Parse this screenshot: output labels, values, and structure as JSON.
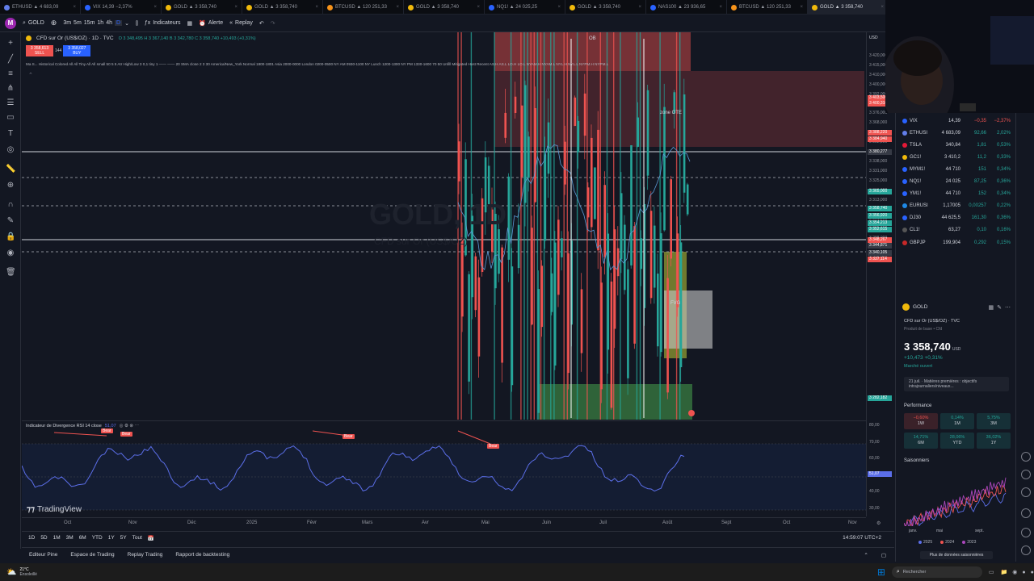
{
  "tabs": [
    {
      "label": "ETHUSD ▲ 4 683,09",
      "color": "#627eea"
    },
    {
      "label": "VIX 14,39 −2,37%",
      "color": "#2962ff"
    },
    {
      "label": "GOLD ▲ 3 358,740",
      "color": "#f0b90b"
    },
    {
      "label": "GOLD ▲ 3 358,740",
      "color": "#f0b90b"
    },
    {
      "label": "BTCUSD ▲ 120 251,33",
      "color": "#f7931a"
    },
    {
      "label": "GOLD ▲ 3 358,740",
      "color": "#f0b90b"
    },
    {
      "label": "NQ1! ▲ 24 025,25",
      "color": "#2962ff"
    },
    {
      "label": "GOLD ▲ 3 358,740",
      "color": "#f0b90b"
    },
    {
      "label": "NAS100 ▲ 23 936,65",
      "color": "#2962ff"
    },
    {
      "label": "BTCUSD ▲ 120 251,33",
      "color": "#f7931a"
    },
    {
      "label": "GOLD ▲ 3 358,740",
      "color": "#f0b90b"
    }
  ],
  "toolbar": {
    "symbol": "GOLD",
    "intervals": [
      "3m",
      "5m",
      "15m",
      "1h",
      "4h",
      "D"
    ],
    "indicators_label": "Indicateurs",
    "alert_label": "Alerte",
    "replay_label": "Replay"
  },
  "chart": {
    "title": "CFD sur Or (US$/OZ) · 1D · TVC",
    "ohlc": "O 3 348,495  H 3 367,140  B 3 342,780  C 3 358,740  +10,493 (+0,31%)",
    "sell_price": "3 358,613",
    "sell_label": "SELL",
    "spread": "144",
    "buy_price": "3 358,027",
    "buy_label": "BUY",
    "indicator_line": "Ma S... Historical Colored All All Tiny All All small 50 5 5 Atr High/Low 3 0,1 tiny 1 —— —— 20 SMA close 2 3 30 America/New_York Normal 1800-1801 Asia 2000-0000 London 0200-0500 NY AM 0930-1100 NY Lunch 1200-1300 NY PM 1330-1600 70 50 Unfill Mitigated Host Recent AS.H AS.L LO.H LO.L NYAM.H NYAM.L NYL.H NYL.L NYPM.H NYPM.L",
    "watermark": "GOLD, 1D",
    "watermark_sub": "CFD sur Or (US$/OZ)",
    "ob_label": "OB",
    "zone_label": "zone OTE",
    "fvg_label": "FVG",
    "currency": "USD"
  },
  "price_axis": [
    "3 420,000",
    "3 415,000",
    "3 410,000",
    "3 400,000",
    "3 392,000",
    "3 384,000",
    "3 376,000",
    "3 368,000",
    "3 360,000",
    "3 352,000",
    "3 344,000",
    "3 338,000",
    "3 331,000",
    "3 325,000",
    "3 319,000",
    "3 313,000",
    "3 307,000",
    "3 301,000",
    "3 295,000",
    "3 288,000",
    "3 282,000",
    "3 276,000"
  ],
  "price_tags": [
    {
      "v": "3 403,500",
      "c": "#ef5350"
    },
    {
      "v": "3 400,310",
      "c": "#ef5350"
    },
    {
      "v": "3 388,220",
      "c": "#ef5350"
    },
    {
      "v": "3 384,940",
      "c": "#ef5350"
    },
    {
      "v": "3 380,277",
      "c": "#363a45"
    },
    {
      "v": "3 365,000",
      "c": "#26a69a"
    },
    {
      "v": "3 358,740",
      "c": "#26a69a"
    },
    {
      "v": "3 356,920",
      "c": "#26a69a"
    },
    {
      "v": "3 354,213",
      "c": "#26a69a"
    },
    {
      "v": "3 352,615",
      "c": "#26a69a"
    },
    {
      "v": "3 348,267",
      "c": "#ef5350"
    },
    {
      "v": "3 344,871",
      "c": "#363a45"
    },
    {
      "v": "3 340,105",
      "c": "#363a45"
    },
    {
      "v": "3 337,114",
      "c": "#ef5350"
    },
    {
      "v": "3 282,182",
      "c": "#26a69a"
    }
  ],
  "rsi": {
    "title": "Indicateur de Divergence RSI 14 close",
    "value": "51,07",
    "bear_label": "Bear",
    "axis": [
      "80,00",
      "70,00",
      "60,00",
      "50,00",
      "40,00",
      "30,00"
    ],
    "current_tag": "51,07"
  },
  "time_axis": [
    "Oct",
    "Nov",
    "Déc",
    "2025",
    "Févr",
    "Mars",
    "Avr",
    "Mai",
    "Juin",
    "Juil",
    "Août",
    "Sept",
    "Oct",
    "Nov"
  ],
  "tradingview_brand": "TradingView",
  "range_buttons": [
    "1D",
    "5D",
    "1M",
    "3M",
    "6M",
    "YTD",
    "1Y",
    "5Y",
    "Tout"
  ],
  "clock": "14:59:07 UTC+2",
  "bottom_tabs": [
    "Editeur Pine",
    "Espace de Trading",
    "Replay Trading",
    "Rapport de backtesting"
  ],
  "watchlist": [
    {
      "sym": "VIX",
      "last": "14,39",
      "chg": "−0,35",
      "pct": "−2,37%",
      "dir": "dn",
      "icon": "#2962ff"
    },
    {
      "sym": "ETHUSI",
      "last": "4 683,09",
      "chg": "92,66",
      "pct": "2,02%",
      "dir": "up",
      "icon": "#627eea"
    },
    {
      "sym": "TSLA",
      "last": "340,84",
      "chg": "1,81",
      "pct": "0,53%",
      "dir": "up",
      "icon": "#e31937"
    },
    {
      "sym": "GC1!",
      "last": "3 410,2",
      "chg": "11,2",
      "pct": "0,33%",
      "dir": "up",
      "icon": "#f0b90b"
    },
    {
      "sym": "MYM1!",
      "last": "44 710",
      "chg": "151",
      "pct": "0,34%",
      "dir": "up",
      "icon": "#2962ff"
    },
    {
      "sym": "NQ1!",
      "last": "24 025",
      "chg": "87,25",
      "pct": "0,36%",
      "dir": "up",
      "icon": "#2962ff"
    },
    {
      "sym": "YM1!",
      "last": "44 710",
      "chg": "152",
      "pct": "0,34%",
      "dir": "up",
      "icon": "#2962ff"
    },
    {
      "sym": "EURUSI",
      "last": "1,17005",
      "chg": "0,00257",
      "pct": "0,22%",
      "dir": "up",
      "icon": "#1e88e5"
    },
    {
      "sym": "DJ30",
      "last": "44 625,5",
      "chg": "161,30",
      "pct": "0,36%",
      "dir": "up",
      "icon": "#2962ff"
    },
    {
      "sym": "CL1!",
      "last": "63,27",
      "chg": "0,10",
      "pct": "0,16%",
      "dir": "up",
      "icon": "#555"
    },
    {
      "sym": "GBPJP",
      "last": "199,904",
      "chg": "0,292",
      "pct": "0,15%",
      "dir": "up",
      "icon": "#c62828"
    }
  ],
  "details": {
    "symbol": "GOLD",
    "name": "CFD sur Or (US$/OZ) · TVC",
    "type": "Produit de base • Cfd",
    "price": "3 358,740",
    "currency": "USD",
    "change": "+10,473  +0,31%",
    "status": "Marché ouvert",
    "news": "21 juil. · Matières premières : objectifs intrajournaliers/niveaux...",
    "performance_title": "Performance",
    "perf": [
      {
        "v": "−0,60%",
        "p": "1W",
        "dir": "dn"
      },
      {
        "v": "0,14%",
        "p": "1M",
        "dir": "up"
      },
      {
        "v": "5,75%",
        "p": "3M",
        "dir": "up"
      },
      {
        "v": "14,71%",
        "p": "6M",
        "dir": "up"
      },
      {
        "v": "28,06%",
        "p": "YTD",
        "dir": "up"
      },
      {
        "v": "36,02%",
        "p": "1Y",
        "dir": "up"
      }
    ],
    "seasonals_title": "Saisonniers",
    "seasonal_axis": [
      "janv.",
      "mai",
      "sept."
    ],
    "seasonal_legend": [
      "2025",
      "2024",
      "2023"
    ],
    "more_seasonals": "Plus de données saisonnières"
  },
  "taskbar": {
    "weather": "21°C",
    "weather_sub": "Ensoleillé",
    "search_placeholder": "Rechercher"
  },
  "colors": {
    "bull": "#26a69a",
    "bear": "#ef5350",
    "rsi": "#5b6ee8",
    "accent": "#2962ff"
  }
}
